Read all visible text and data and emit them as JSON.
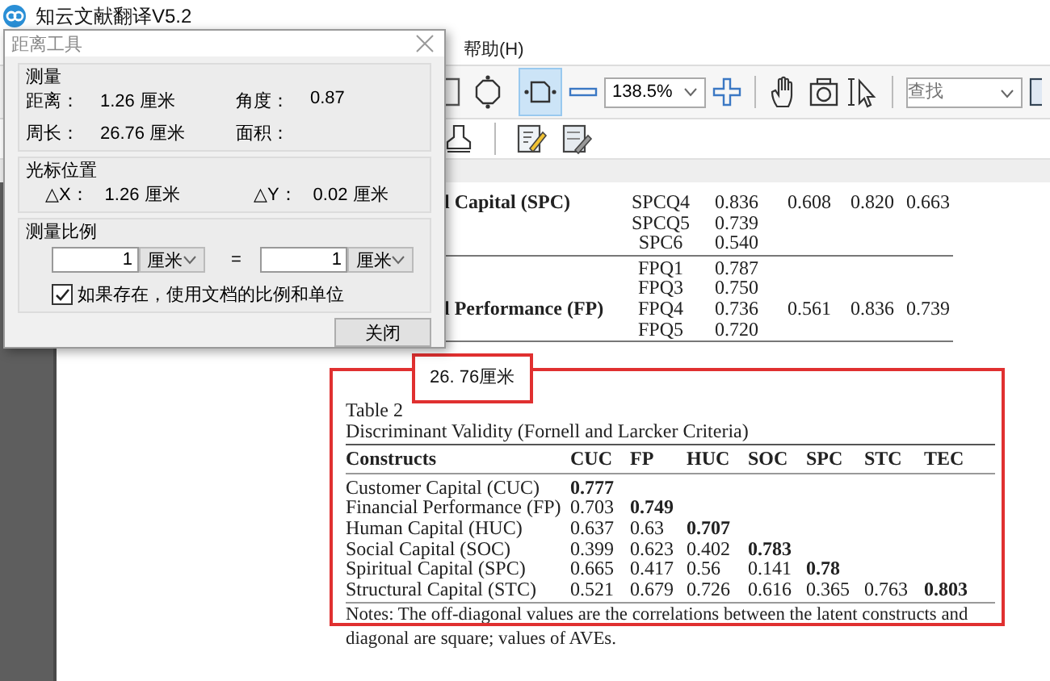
{
  "window": {
    "title": "知云文献翻译V5.2"
  },
  "menu": [
    {
      "label": "帮助(H)"
    }
  ],
  "toolbar": {
    "fit_buttons": [
      {
        "selected": false
      },
      {
        "selected": true
      }
    ],
    "zoom": {
      "value": "138.5%"
    },
    "search": {
      "placeholder": "查找"
    }
  },
  "table_1": {
    "groups": [
      {
        "rows": [
          {
            "column_1": "l Capital (SPC)",
            "column_2": "SPCQ4",
            "column_3": "0.836",
            "column_4": "0.608",
            "column_5": "0.820",
            "column_6": "0.663"
          },
          {
            "column_2": "SPCQ5",
            "column_3": "0.739"
          },
          {
            "column_2": "SPC6",
            "column_3": "0.540"
          }
        ]
      },
      {
        "rows": [
          {
            "column_2": "FPQ1",
            "column_3": "0.787"
          },
          {
            "column_2": "FPQ3",
            "column_3": "0.750"
          },
          {
            "column_1": "l Performance (FP)",
            "column_2": "FPQ4",
            "column_3": "0.736",
            "column_4": "0.561",
            "column_5": "0.836",
            "column_6": "0.739"
          },
          {
            "column_2": "FPQ5",
            "column_3": "0.720"
          }
        ]
      }
    ]
  },
  "annotation": {
    "text": "26. 76厘米"
  },
  "table_2": {
    "label": "Table 2",
    "title": "Discriminant Validity (Fornell and Larcker Criteria)",
    "columns": [
      "Constructs",
      "CUC",
      "FP",
      "HUC",
      "SOC",
      "SPC",
      "STC",
      "TEC"
    ],
    "rows": [
      {
        "cells": [
          {
            "text": "Customer Capital (CUC)",
            "bold": false
          },
          {
            "text": "0.777",
            "bold": true
          }
        ]
      },
      {
        "cells": [
          {
            "text": "Financial Performance (FP)",
            "bold": false
          },
          {
            "text": "0.703",
            "bold": false
          },
          {
            "text": "0.749",
            "bold": true
          }
        ]
      },
      {
        "cells": [
          {
            "text": "Human Capital (HUC)",
            "bold": false
          },
          {
            "text": "0.637",
            "bold": false
          },
          {
            "text": "0.63",
            "bold": false
          },
          {
            "text": "0.707",
            "bold": true
          }
        ]
      },
      {
        "cells": [
          {
            "text": "Social Capital (SOC)",
            "bold": false
          },
          {
            "text": "0.399",
            "bold": false
          },
          {
            "text": "0.623",
            "bold": false
          },
          {
            "text": "0.402",
            "bold": false
          },
          {
            "text": "0.783",
            "bold": true
          }
        ]
      },
      {
        "cells": [
          {
            "text": "Spiritual Capital (SPC)",
            "bold": false
          },
          {
            "text": "0.665",
            "bold": false
          },
          {
            "text": "0.417",
            "bold": false
          },
          {
            "text": "0.56",
            "bold": false
          },
          {
            "text": "0.141",
            "bold": false
          },
          {
            "text": "0.78",
            "bold": true
          }
        ]
      },
      {
        "cells": [
          {
            "text": "Structural Capital (STC)",
            "bold": false
          },
          {
            "text": "0.521",
            "bold": false
          },
          {
            "text": "0.679",
            "bold": false
          },
          {
            "text": "0.726",
            "bold": false
          },
          {
            "text": "0.616",
            "bold": false
          },
          {
            "text": "0.365",
            "bold": false
          },
          {
            "text": "0.763",
            "bold": false
          },
          {
            "text": "0.803",
            "bold": true
          }
        ]
      }
    ],
    "notes": "Notes: The off-diagonal values are the correlations between the latent constructs and diagonal are square; values of AVEs."
  },
  "dialog": {
    "title": "距离工具",
    "measure": {
      "title": "测量",
      "fields": [
        {
          "label": "距离：",
          "value": "1.26 厘米"
        },
        {
          "label": "角度：",
          "value": "0.87"
        },
        {
          "label": "周长：",
          "value": "26.76 厘米"
        },
        {
          "label": "面积："
        }
      ]
    },
    "cursor": {
      "title": "光标位置",
      "fields": [
        {
          "label": "△X：",
          "value": "1.26 厘米"
        },
        {
          "label": "△Y：",
          "value": "0.02 厘米"
        }
      ]
    },
    "scale": {
      "title": "测量比例",
      "left": {
        "value": "1",
        "unit": "厘米"
      },
      "equals": "=",
      "right": {
        "value": "1",
        "unit": "厘米"
      },
      "use_document": {
        "label": "如果存在，使用文档的比例和单位",
        "checked": true
      }
    },
    "close_button": "关闭"
  }
}
